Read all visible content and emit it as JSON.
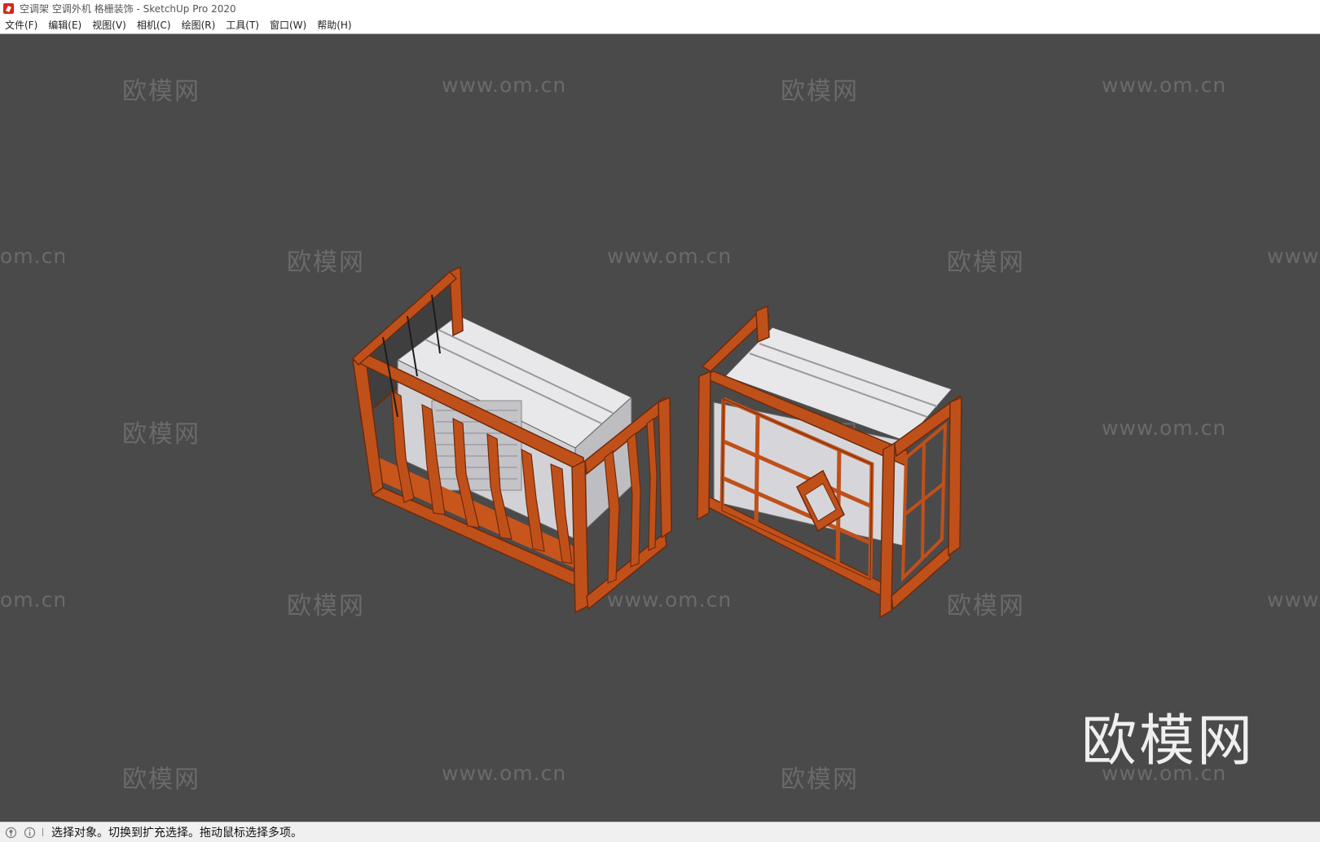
{
  "window": {
    "title": "空调架 空调外机 格栅装饰 - SketchUp Pro 2020",
    "app_icon": "sketchup-logo-icon"
  },
  "menubar": {
    "items": [
      "文件(F)",
      "编辑(E)",
      "视图(V)",
      "相机(C)",
      "绘图(R)",
      "工具(T)",
      "窗口(W)",
      "帮助(H)"
    ]
  },
  "viewport": {
    "background": "#4a4a4a",
    "watermark_cn": "欧模网",
    "watermark_url": "www.om.cn",
    "watermark_url_partial_left": "om.cn",
    "watermark_url_partial_right": "www.",
    "watermark_big": "欧模网",
    "models": [
      "ac-unit-cage-branch-pattern",
      "ac-unit-cage-lattice-pattern"
    ],
    "colors": {
      "wood": "#c0501a",
      "wood_dark": "#6e2a0c",
      "unit_top": "#d9d9dc"
    }
  },
  "statusbar": {
    "icons": [
      "geo-location-icon",
      "info-icon"
    ],
    "message": "选择对象。切换到扩充选择。拖动鼠标选择多项。"
  }
}
